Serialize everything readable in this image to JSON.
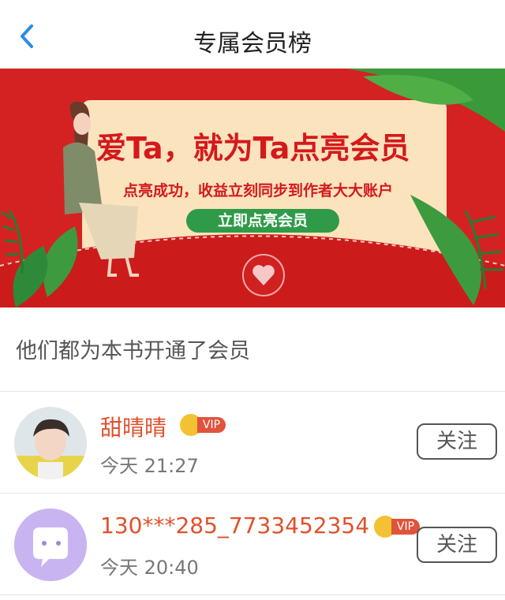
{
  "nav": {
    "title": "专属会员榜",
    "back_icon": "chevron-left-icon"
  },
  "banner": {
    "headline": "爱Ta，就为Ta点亮会员",
    "subline": "点亮成功，收益立刻同步到作者大大账户",
    "cta": "立即点亮会员"
  },
  "section": {
    "heading": "他们都为本书开通了会员"
  },
  "members": [
    {
      "name": "甜晴晴",
      "badge": "VIP",
      "time": "今天 21:27",
      "follow": "关注"
    },
    {
      "name": "130***285_7733452354",
      "badge": "VIP",
      "time": "今天 20:40",
      "follow": "关注"
    }
  ],
  "colors": {
    "accent": "#e0512b",
    "banner_red": "#d42222",
    "cta_green": "#2f9a48",
    "back_blue": "#2a8de6"
  }
}
